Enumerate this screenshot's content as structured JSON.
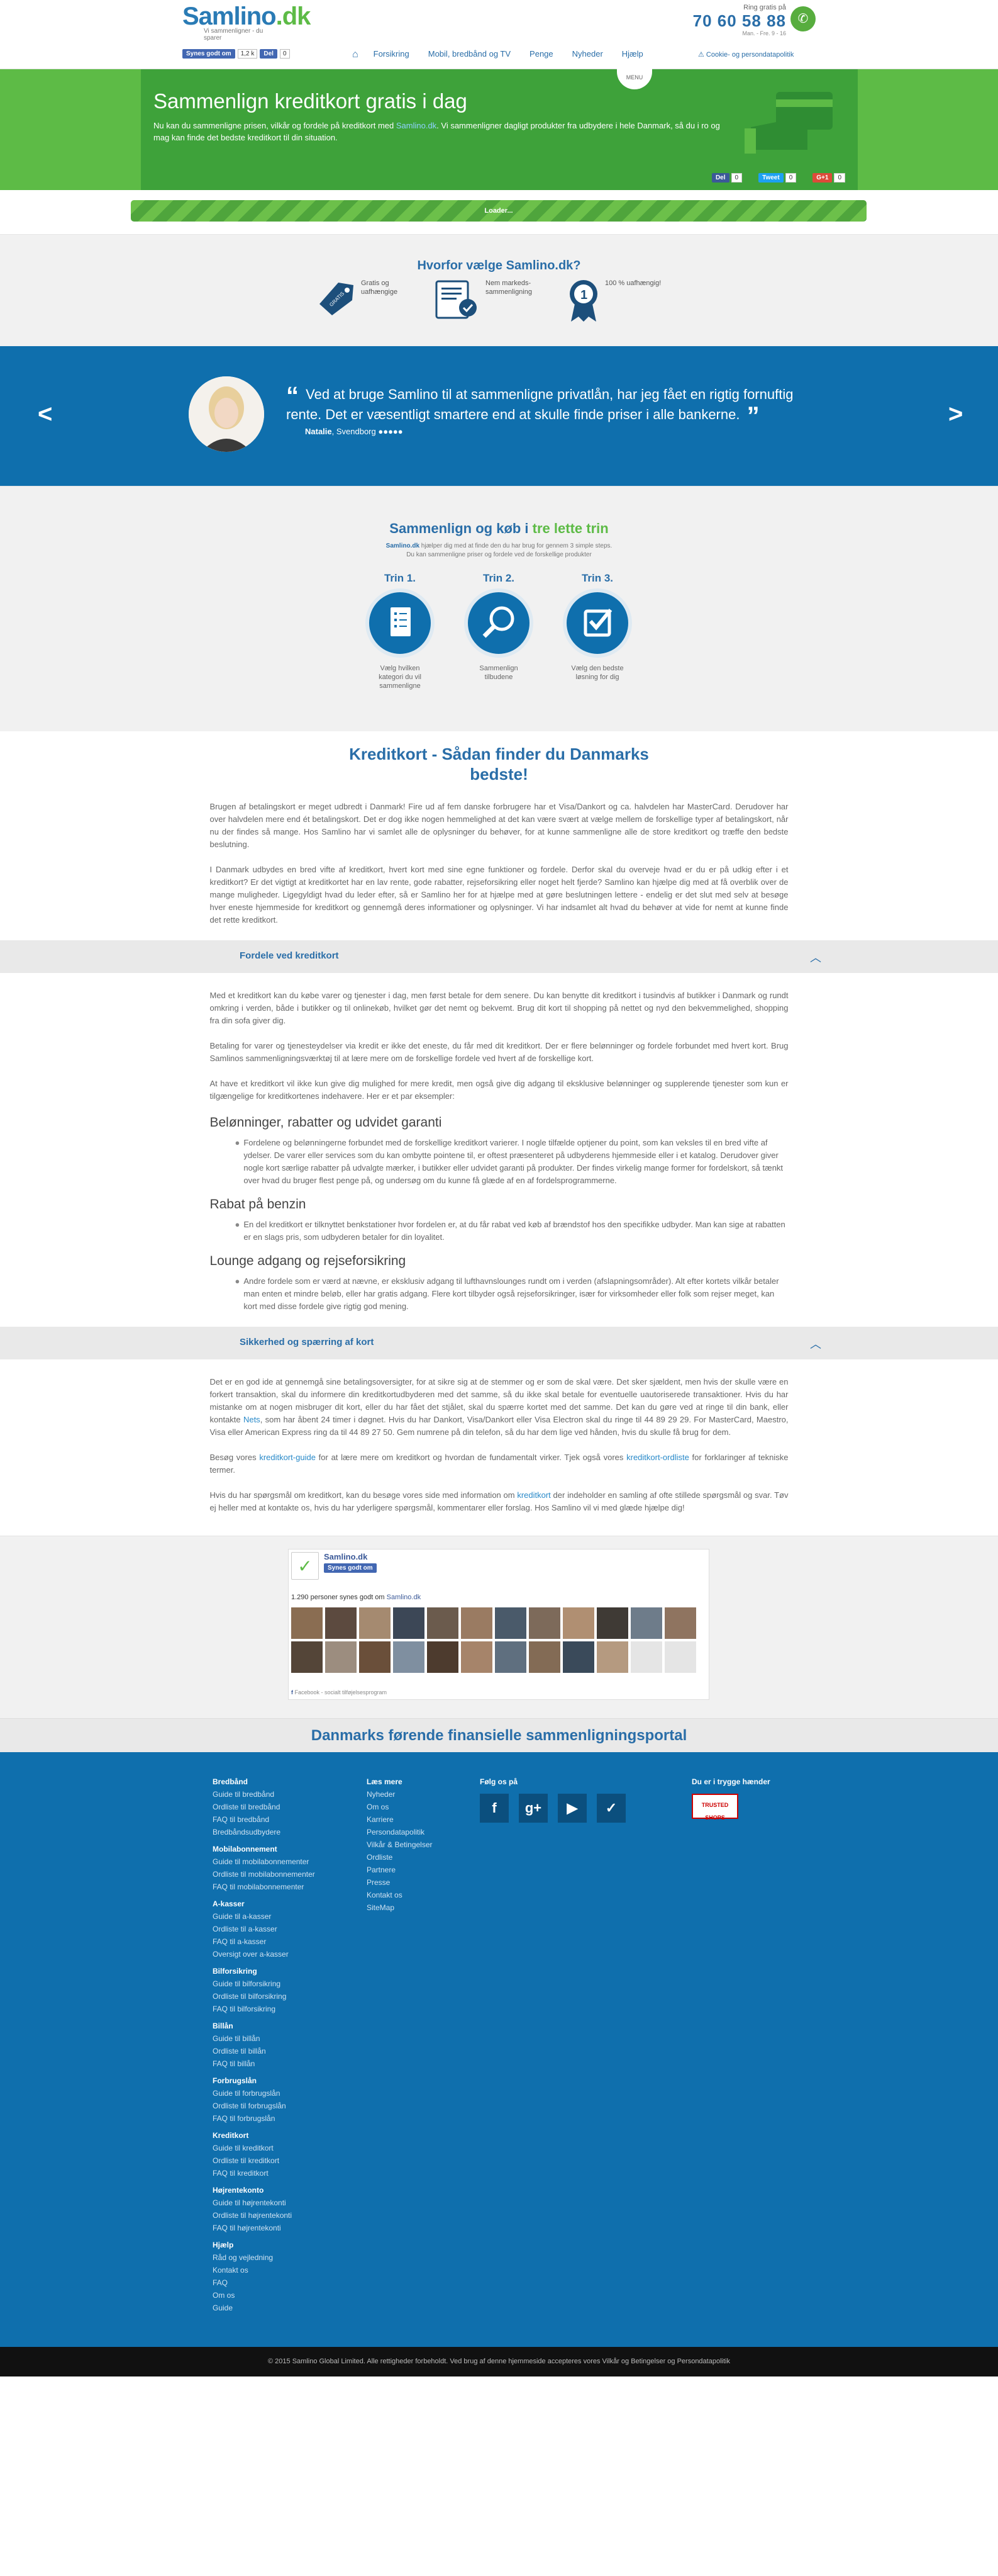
{
  "header": {
    "logo_text": "Samlino",
    "logo_tld": ".dk",
    "logo_tagline": "Vi sammenligner - du sparer",
    "phone_label": "Ring gratis på",
    "phone": "70 60 58 88",
    "hours": "Man. - Fre. 9 - 16",
    "fb_like": "Synes godt om",
    "fb_like_count": "1,2 k",
    "fb_share": "Del",
    "fb_share_count": "0",
    "nav": [
      "Forsikring",
      "Mobil, bredbånd og TV",
      "Penge",
      "Nyheder",
      "Hjælp"
    ],
    "cookie": "Cookie- og persondatapolitik"
  },
  "hero": {
    "menu_label": "MENU",
    "title": "Sammenlign kreditkort gratis i dag",
    "text_before": "Nu kan du sammenligne prisen, vilkår og fordele på kreditkort med ",
    "text_link": "Samlino.dk",
    "text_after": ". Vi sammenligner dagligt produkter fra udbydere i hele Danmark, så du i ro og mag kan finde det bedste kreditkort til din situation.",
    "share": [
      {
        "label": "Del",
        "count": "0",
        "color": "#3b5998"
      },
      {
        "label": "Tweet",
        "count": "0",
        "color": "#1da1f2"
      },
      {
        "label": "G+1",
        "count": "0",
        "color": "#dd4b39"
      }
    ]
  },
  "loader": {
    "label": "Loader..."
  },
  "why": {
    "title": "Hvorfor vælge Samlino.dk?",
    "items": [
      {
        "icon": "gratis-tag-icon",
        "text": "Gratis og uafhængige",
        "badge": "GRATIS"
      },
      {
        "icon": "document-check-icon",
        "text": "Nem markeds-sammenligning"
      },
      {
        "icon": "medal-icon",
        "text": "100 % uafhængig!",
        "badge": "1"
      }
    ]
  },
  "testimonial": {
    "quote": "Ved at bruge Samlino til at sammenligne privatlån, har jeg fået en rigtig fornuftig rente. Det er væsentligt smartere end at skulle finde priser i alle bankerne.",
    "author": "Natalie",
    "city": ", Svendborg",
    "stars": "●●●●●"
  },
  "steps": {
    "title_a": "Sammenlign og køb i ",
    "title_b": "tre lette trin",
    "sub_brand": "Samlino.dk",
    "sub1": " hjælper dig med at finde den du har brug for gennem 3 simple steps.",
    "sub2": "Du kan sammenligne priser og fordele ved de forskellige produkter",
    "items": [
      {
        "head": "Trin 1.",
        "text": "Vælg hvilken kategori du vil sammenligne",
        "icon": "list-icon"
      },
      {
        "head": "Trin 2.",
        "text": "Sammenlign tilbudene",
        "icon": "magnifier-icon"
      },
      {
        "head": "Trin 3.",
        "text": "Vælg den bedste løsning for dig",
        "icon": "checkbox-icon"
      }
    ]
  },
  "article": {
    "title": "Kreditkort - Sådan finder du Danmarks bedste!",
    "p1": "Brugen af betalingskort er meget udbredt i Danmark! Fire ud af fem danske forbrugere har et Visa/Dankort og ca. halvdelen har MasterCard. Derudover har over halvdelen mere end ét betalingskort. Det er dog ikke nogen hemmelighed at det kan være svært at vælge mellem de forskellige typer af betalingskort, når nu der findes så mange. Hos Samlino har vi samlet alle de oplysninger du behøver, for at kunne sammenligne alle de store kreditkort og træffe den bedste beslutning.",
    "p2": "I Danmark udbydes en bred vifte af kreditkort, hvert kort med sine egne funktioner og fordele. Derfor skal du overveje hvad er du er på udkig efter i et kreditkort? Er det vigtigt at kreditkortet har en lav rente, gode rabatter, rejseforsikring eller noget helt fjerde? Samlino kan hjælpe dig med at få overblik over de mange muligheder. Ligegyldigt hvad du leder efter, så er Samlino her for at hjælpe med at gøre beslutningen lettere - endelig er det slut med selv at besøge hver eneste hjemmeside for kreditkort og gennemgå deres informationer og oplysninger. Vi har indsamlet alt hvad du behøver at vide for nemt at kunne finde det rette kreditkort.",
    "sec1": "Fordele ved kreditkort",
    "s1p1": "Med et kreditkort kan du købe varer og tjenester i dag, men først betale for dem senere. Du kan benytte dit kreditkort i tusindvis af butikker i Danmark og rundt omkring i verden, både i butikker og til onlinekøb, hvilket gør det nemt og bekvemt. Brug dit kort til shopping på nettet og nyd den bekvemmelighed, shopping fra din sofa giver dig.",
    "s1p2": "Betaling for varer og tjenesteydelser via kredit er ikke det eneste, du får med dit kreditkort. Der er flere belønninger og fordele forbundet med hvert kort. Brug Samlinos sammenligningsværktøj til at lære mere om de forskellige fordele ved hvert af de forskellige kort.",
    "s1p3": "At have et kreditkort vil ikke kun give dig mulighed for mere kredit, men også give dig adgang til eksklusive belønninger og supplerende tjenester som kun er tilgængelige for kreditkortenes indehavere. Her er et par eksempler:",
    "h_a": "Belønninger, rabatter og udvidet garanti",
    "b_a": "Fordelene og belønningerne forbundet med de forskellige kreditkort varierer. I nogle tilfælde optjener du point, som kan veksles til en bred vifte af ydelser. De varer eller services som du kan ombytte pointene til, er oftest præsenteret på udbyderens hjemmeside eller i et katalog. Derudover giver nogle kort særlige rabatter på udvalgte mærker, i butikker eller udvidet garanti på produkter. Der findes virkelig mange former for fordelskort, så tænkt over hvad du bruger flest penge på, og undersøg om du kunne få glæde af en af fordelsprogrammerne.",
    "h_b": "Rabat på benzin",
    "b_b": "En del kreditkort er tilknyttet benkstationer hvor fordelen er, at du får rabat ved køb af brændstof hos den specifikke udbyder. Man kan sige at rabatten er en slags pris, som udbyderen betaler for din loyalitet.",
    "h_c": "Lounge adgang og rejseforsikring",
    "b_c": "Andre fordele som er værd at nævne, er eksklusiv adgang til lufthavnslounges rundt om i verden (afslapningsområder). Alt efter kortets vilkår betaler man enten et mindre beløb, eller har gratis adgang. Flere kort tilbyder også rejseforsikringer, især for virksomheder eller folk som rejser meget, kan kort med disse fordele give rigtig god mening.",
    "sec2": "Sikkerhed og spærring af kort",
    "s2p1a": "Det er en god ide at gennemgå sine betalingsoversigter, for at sikre sig at de stemmer og er som de skal være. Det sker sjældent, men hvis der skulle være en forkert transaktion, skal du informere din kreditkortudbyderen med det samme, så du ikke skal betale for eventuelle uautoriserede transaktioner. Hvis du har mistanke om at nogen misbruger dit kort, eller du har fået det stjålet, skal du spærre kortet med det samme. Det kan du gøre ved at ringe til din bank, eller kontakte ",
    "s2p1link": "Nets",
    "s2p1b": ", som har åbent 24 timer i døgnet. Hvis du har Dankort, Visa/Dankort eller Visa Electron skal du ringe til 44 89 29 29. For MasterCard, Maestro, Visa eller American Express ring da til 44 89 27 50. Gem numrene på din telefon, så du har dem lige ved hånden, hvis du skulle få brug for dem.",
    "s2p2a": "Besøg vores ",
    "s2p2link1": "kreditkort-guide",
    "s2p2b": " for at lære mere om kreditkort og hvordan de fundamentalt virker. Tjek også vores ",
    "s2p2link2": "kreditkort-ordliste",
    "s2p2c": " for forklaringer af tekniske termer.",
    "s2p3a": "Hvis du har spørgsmål om kreditkort, kan du besøge vores side med information om ",
    "s2p3link": "kreditkort",
    "s2p3b": " der indeholder en samling af ofte stillede spørgsmål og svar. Tøv ej heller med at kontakte os, hvis du har yderligere spørgsmål, kommentarer eller forslag. Hos Samlino vil vi med glæde hjælpe dig!"
  },
  "fb_widget": {
    "page_name": "Samlino.dk",
    "like": "Synes godt om",
    "likes_text": "1.290 personer synes godt om ",
    "likes_link": "Samlino.dk",
    "plugin": "Facebook - socialt tilføjelsesprogram"
  },
  "footer": {
    "tagline": "Danmarks førende finansielle sammenligningsportal",
    "col1": [
      {
        "h": "Bredbånd",
        "links": [
          "Guide til bredbånd",
          "Ordliste til bredbånd",
          "FAQ til bredbånd",
          "Bredbåndsudbydere"
        ]
      },
      {
        "h": "Mobilabonnement",
        "links": [
          "Guide til mobilabonnementer",
          "Ordliste til mobilabonnementer",
          "FAQ til mobilabonnementer"
        ]
      },
      {
        "h": "A-kasser",
        "links": [
          "Guide til a-kasser",
          "Ordliste til a-kasser",
          "FAQ til a-kasser",
          "Oversigt over a-kasser"
        ]
      },
      {
        "h": "Bilforsikring",
        "links": [
          "Guide til bilforsikring",
          "Ordliste til bilforsikring",
          "FAQ til bilforsikring"
        ]
      },
      {
        "h": "Billån",
        "links": [
          "Guide til billån",
          "Ordliste til billån",
          "FAQ til billån"
        ]
      },
      {
        "h": "Forbrugslån",
        "links": [
          "Guide til forbrugslån",
          "Ordliste til forbrugslån",
          "FAQ til forbrugslån"
        ]
      },
      {
        "h": "Kreditkort",
        "links": [
          "Guide til kreditkort",
          "Ordliste til kreditkort",
          "FAQ til kreditkort"
        ]
      },
      {
        "h": "Højrentekonto",
        "links": [
          "Guide til højrentekonti",
          "Ordliste til højrentekonti",
          "FAQ til højrentekonti"
        ]
      },
      {
        "h": "Hjælp",
        "links": [
          "Råd og vejledning",
          "Kontakt os",
          "FAQ",
          "Om os",
          "Guide"
        ]
      }
    ],
    "col2": {
      "h": "Læs mere",
      "links": [
        "Nyheder",
        "Om os",
        "Karriere",
        "Persondatapolitik",
        "Vilkår & Betingelser",
        "Ordliste",
        "Partnere",
        "Presse",
        "Kontakt os",
        "SiteMap"
      ]
    },
    "col3": {
      "h": "Følg os på",
      "icons": [
        "f",
        "g+",
        "▶",
        "✓"
      ]
    },
    "col4": {
      "h": "Du er i trygge hænder",
      "badge": "TRUSTED SHOPS"
    },
    "copyright": "© 2015 Samlino Global Limited. Alle rettigheder forbeholdt. Ved brug af denne hjemmeside accepteres vores Vilkår og Betingelser og Persondatapolitik"
  }
}
